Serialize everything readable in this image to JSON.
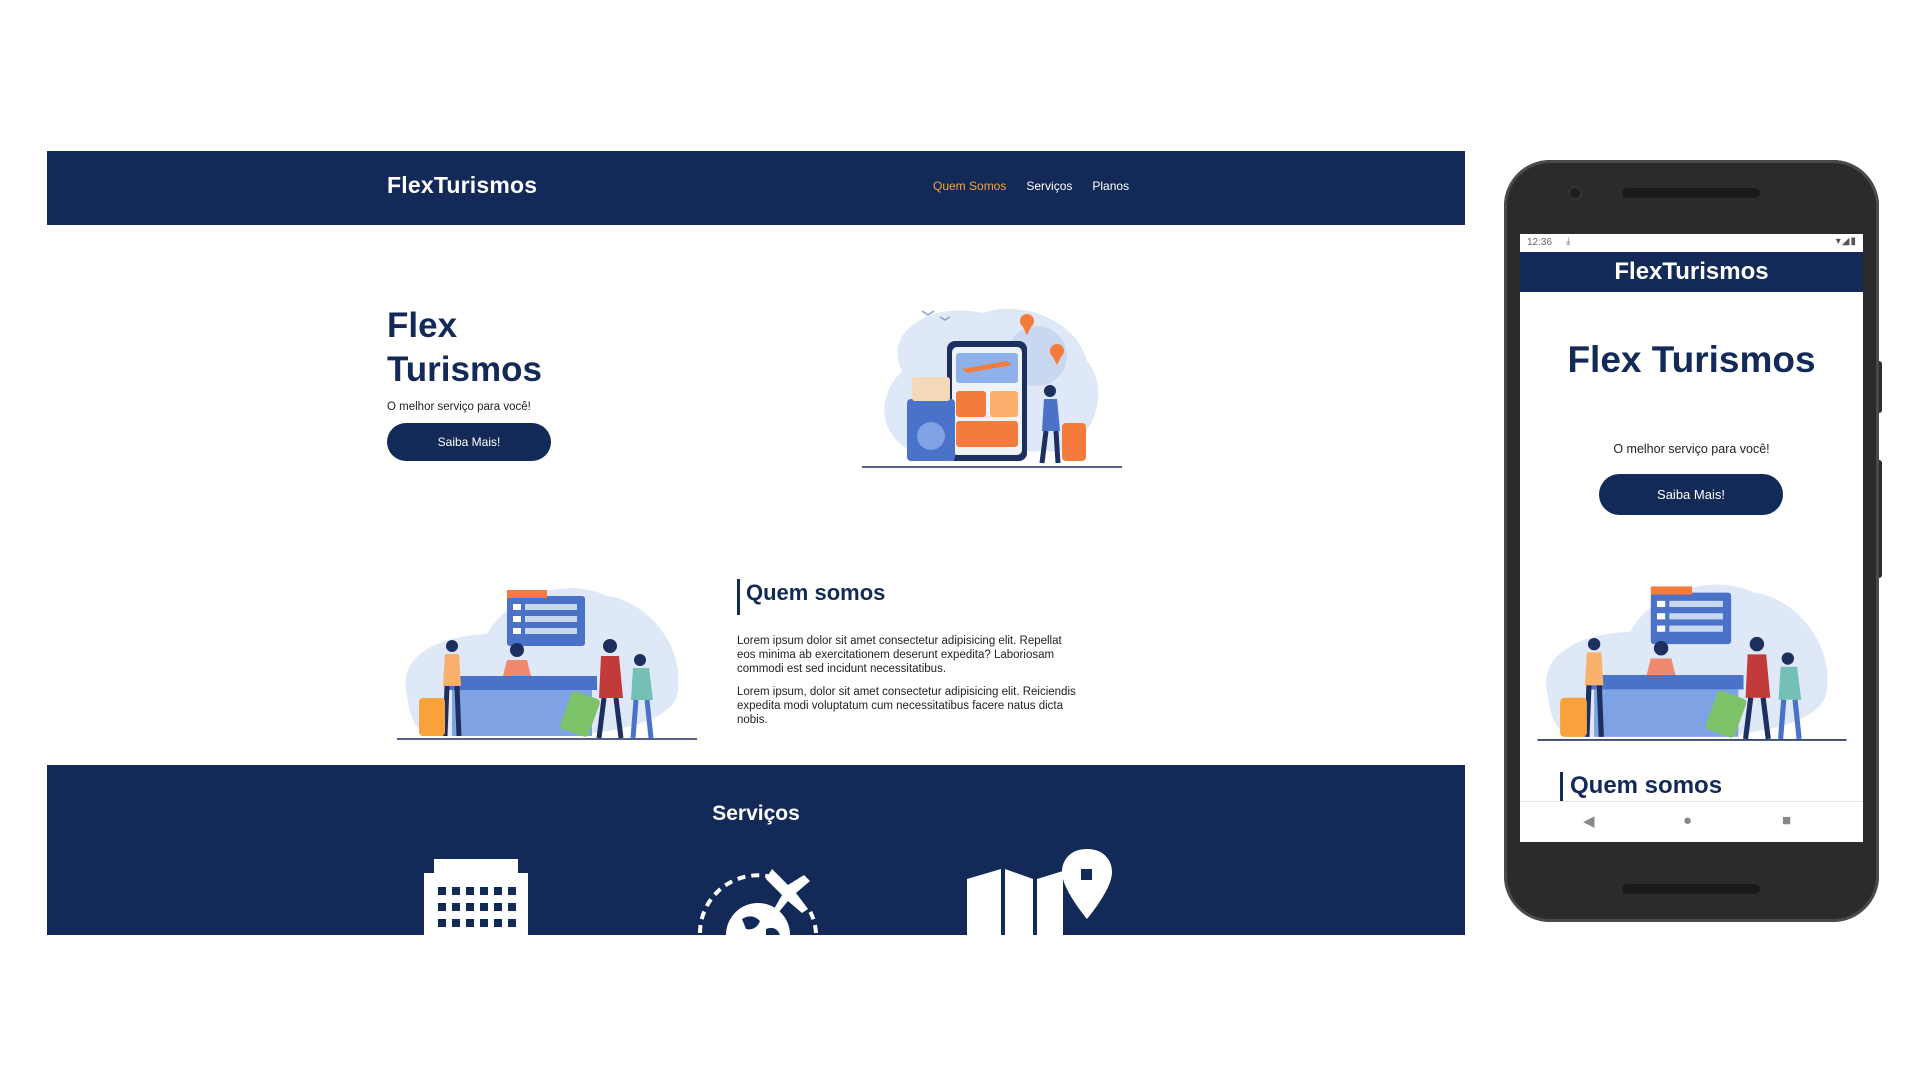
{
  "desktop": {
    "brand": "FlexTurismos",
    "menu": [
      "Quem Somos",
      "Serviços",
      "Planos"
    ],
    "active_menu_color": "#f2a33a",
    "hero": {
      "title": "Flex Turismos",
      "subtitle": "O melhor serviço para você!",
      "button": "Saiba Mais!"
    },
    "about": {
      "title": "Quem somos",
      "p1": "Lorem ipsum dolor sit amet consectetur adipisicing elit. Repellat eos minima ab exercitationem deserunt expedita? Laboriosam commodi est sed incidunt necessitatibus.",
      "p2": "Lorem ipsum, dolor sit amet consectetur adipisicing elit. Reiciendis expedita modi voluptatum cum necessitatibus facere natus dicta nobis."
    },
    "services": {
      "title": "Serviços",
      "icons": [
        "hotel-icon",
        "world-travel-icon",
        "map-location-icon"
      ]
    }
  },
  "phone": {
    "status_time": "12:36",
    "brand": "FlexTurismos",
    "hero": {
      "title": "Flex Turismos",
      "subtitle": "O melhor serviço para você!",
      "button": "Saiba Mais!"
    },
    "about_title": "Quem somos",
    "navbar_icons": [
      "back-icon",
      "home-icon",
      "recents-icon"
    ]
  },
  "colors": {
    "primary": "#132a58",
    "accent": "#f2a33a",
    "background": "#ffffff"
  }
}
